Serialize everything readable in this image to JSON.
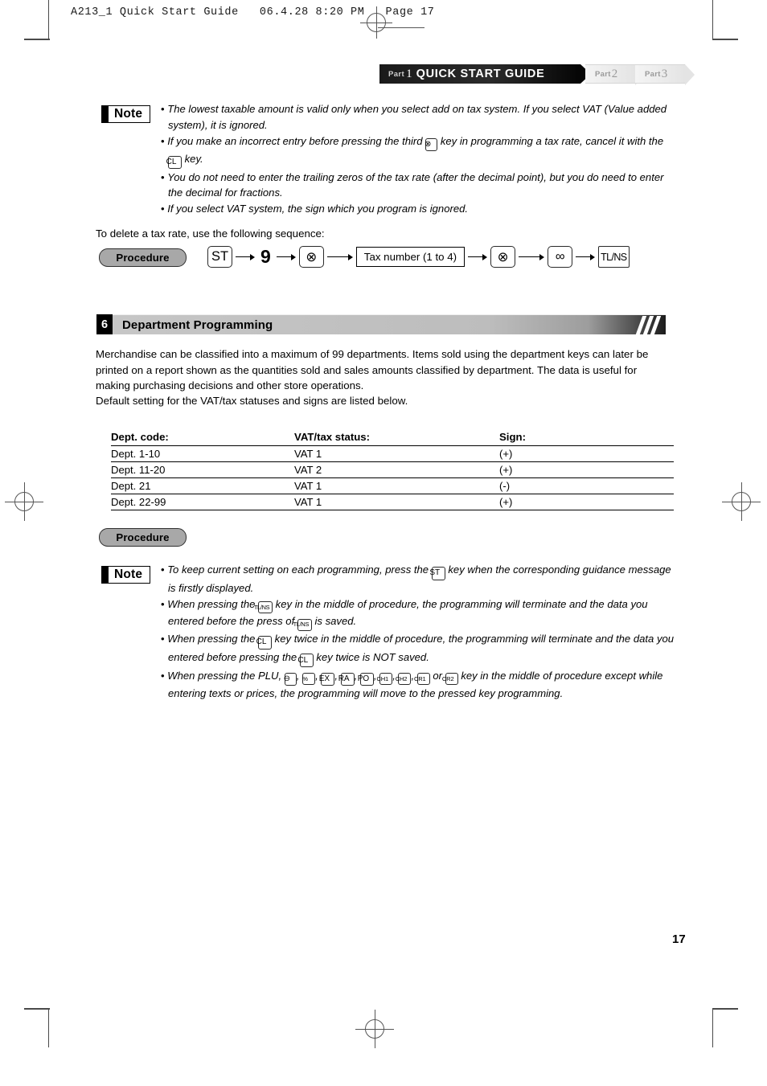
{
  "file_header": {
    "text": "A213_1 Quick Start Guide   06.4.28 8:20 PM   Page 17"
  },
  "tabs": {
    "active": {
      "part_label": "Part",
      "part_number": "1",
      "title": "QUICK START GUIDE"
    },
    "inactive": [
      {
        "part_label": "Part",
        "part_number": "2"
      },
      {
        "part_label": "Part",
        "part_number": "3"
      }
    ]
  },
  "note_badge_label": "Note",
  "note_top": {
    "bullet_char": "•",
    "items": [
      {
        "segments": [
          {
            "type": "text",
            "value": "The lowest taxable amount is valid only when you select add on tax system. If you select VAT (Value added system), it is ignored."
          }
        ]
      },
      {
        "segments": [
          {
            "type": "text",
            "value": "If you make an incorrect entry before pressing the third "
          },
          {
            "type": "key",
            "value": "⊗",
            "style": "circ"
          },
          {
            "type": "text",
            "value": " key in programming a tax rate, cancel it with the "
          },
          {
            "type": "key",
            "value": "CL",
            "style": "sm"
          },
          {
            "type": "text",
            "value": " key."
          }
        ]
      },
      {
        "segments": [
          {
            "type": "text",
            "value": "You do not need to enter the trailing zeros of the tax rate (after the decimal point), but you do need to enter the decimal for fractions."
          }
        ]
      },
      {
        "segments": [
          {
            "type": "text",
            "value": "If you select VAT system, the sign which you program is ignored."
          }
        ]
      }
    ]
  },
  "delete_intro": "To delete a tax rate, use the following sequence:",
  "procedure_label": "Procedure",
  "sequence": [
    {
      "kind": "key",
      "label": "ST"
    },
    {
      "kind": "arrow"
    },
    {
      "kind": "num",
      "label": "9"
    },
    {
      "kind": "arrow"
    },
    {
      "kind": "key",
      "label": "⊗"
    },
    {
      "kind": "arrow-long"
    },
    {
      "kind": "box",
      "label": "Tax number (1 to 4)"
    },
    {
      "kind": "arrow"
    },
    {
      "kind": "key",
      "label": "⊗"
    },
    {
      "kind": "arrow-long"
    },
    {
      "kind": "key",
      "label": "∞"
    },
    {
      "kind": "arrow"
    },
    {
      "kind": "keytl",
      "label": "TL/NS"
    }
  ],
  "section": {
    "number": "6",
    "title": "Department Programming"
  },
  "body_paragraph_1": "Merchandise can be classified into a maximum of 99 departments.  Items sold using the department keys can later be printed on a report shown as the quantities sold and sales amounts classified by department.  The data is useful for making purchasing decisions and other store operations.",
  "body_paragraph_2": "Default setting for the VAT/tax statuses and signs are listed below.",
  "table": {
    "headers": [
      "Dept. code:",
      "VAT/tax status:",
      "Sign:"
    ],
    "rows": [
      [
        "Dept. 1-10",
        "VAT 1",
        "(+)"
      ],
      [
        "Dept. 11-20",
        "VAT 2",
        "(+)"
      ],
      [
        "Dept. 21",
        "VAT 1",
        "(-)"
      ],
      [
        "Dept. 22-99",
        "VAT 1",
        "(+)"
      ]
    ]
  },
  "note_bottom": {
    "bullet_char": "•",
    "items": [
      {
        "segments": [
          {
            "type": "text",
            "value": "To keep current setting on each programming, press the "
          },
          {
            "type": "key",
            "value": "ST",
            "style": "sm"
          },
          {
            "type": "text",
            "value": " key when the corresponding guidance message is firstly displayed."
          }
        ]
      },
      {
        "segments": [
          {
            "type": "text",
            "value": "When pressing the "
          },
          {
            "type": "key",
            "value": "TL/NS",
            "style": "tl"
          },
          {
            "type": "text",
            "value": " key in the middle of procedure, the programming will terminate and the data you entered before the press of "
          },
          {
            "type": "key",
            "value": "TL/NS",
            "style": "tl"
          },
          {
            "type": "text",
            "value": " is saved."
          }
        ]
      },
      {
        "segments": [
          {
            "type": "text",
            "value": "When pressing the "
          },
          {
            "type": "key",
            "value": "CL",
            "style": "sm"
          },
          {
            "type": "text",
            "value": " key twice in the middle of procedure, the programming will terminate and the data you entered before pressing the "
          },
          {
            "type": "key",
            "value": "CL",
            "style": "sm"
          },
          {
            "type": "text",
            "value": " key twice is NOT saved."
          }
        ]
      },
      {
        "segments": [
          {
            "type": "text",
            "value": "When pressing the PLU, "
          },
          {
            "type": "key",
            "value": "⊖",
            "style": "circ"
          },
          {
            "type": "text",
            "value": ", "
          },
          {
            "type": "key",
            "value": "%",
            "style": "xs"
          },
          {
            "type": "text",
            "value": ", "
          },
          {
            "type": "key",
            "value": "EX",
            "style": "sm"
          },
          {
            "type": "text",
            "value": ", "
          },
          {
            "type": "key",
            "value": "RA",
            "style": "sm"
          },
          {
            "type": "text",
            "value": ", "
          },
          {
            "type": "key",
            "value": "PO",
            "style": "sm"
          },
          {
            "type": "text",
            "value": ", "
          },
          {
            "type": "key",
            "value": "CH1",
            "style": "xs"
          },
          {
            "type": "text",
            "value": ", "
          },
          {
            "type": "key",
            "value": "CH2",
            "style": "xs"
          },
          {
            "type": "text",
            "value": ", "
          },
          {
            "type": "key",
            "value": "CR1",
            "style": "xs"
          },
          {
            "type": "text",
            "value": " or "
          },
          {
            "type": "key",
            "value": "CR2",
            "style": "xs"
          },
          {
            "type": "text",
            "value": " key in the middle of procedure except while entering texts or prices, the programming will move to the pressed key programming."
          }
        ]
      }
    ]
  },
  "page_number": "17"
}
